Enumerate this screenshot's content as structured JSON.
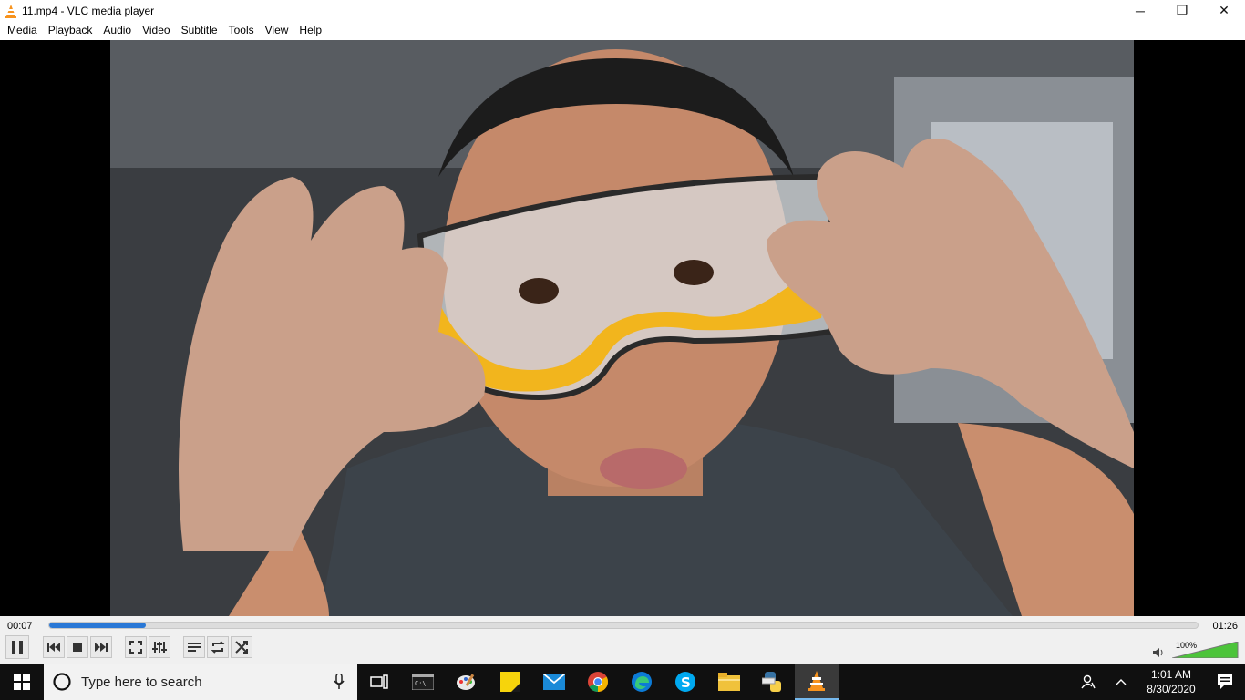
{
  "window": {
    "title": "11.mp4 - VLC media player",
    "controls": {
      "minimize": "─",
      "restore": "❐",
      "close": "✕"
    }
  },
  "menu": [
    "Media",
    "Playback",
    "Audio",
    "Video",
    "Subtitle",
    "Tools",
    "View",
    "Help"
  ],
  "player": {
    "current_time": "00:07",
    "total_time": "01:26",
    "progress_fraction": 0.084,
    "volume_label": "100%",
    "volume_fraction": 1.0,
    "accent_color": "#2a78d6",
    "volume_color": "#4cc43a"
  },
  "taskbar": {
    "search_placeholder": "Type here to search",
    "clock_time": "1:01 AM",
    "clock_date": "8/30/2020"
  }
}
